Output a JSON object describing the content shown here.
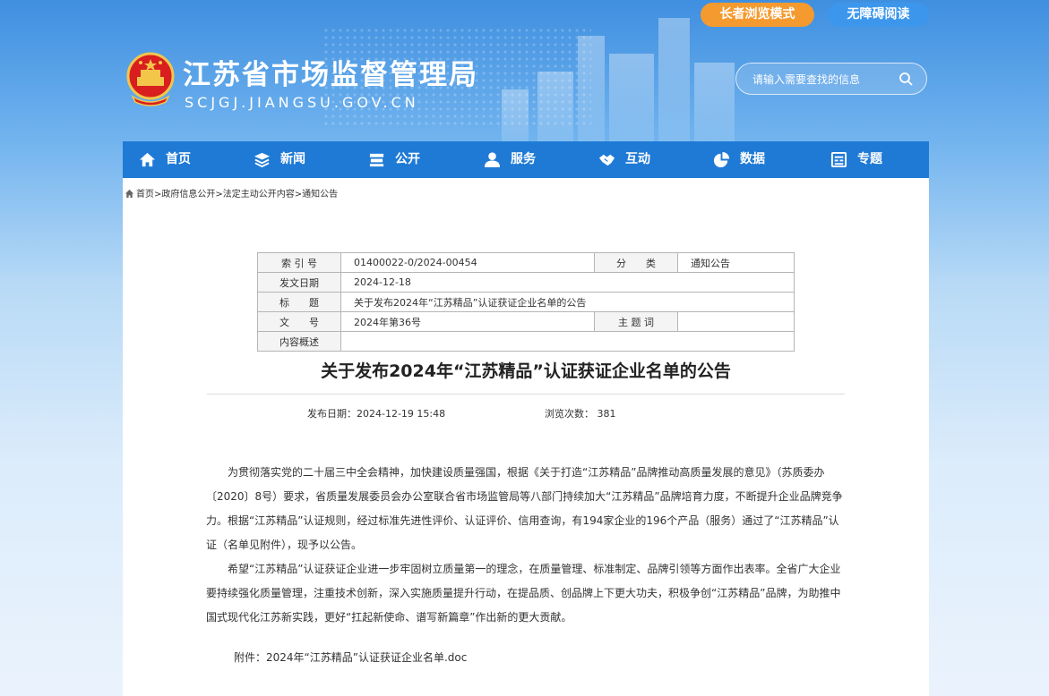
{
  "header": {
    "elder_mode_label": "长者浏览模式",
    "accessibility_label": "无障碍阅读",
    "site_title": "江苏省市场监督管理局",
    "site_url": "SCJGJ.JIANGSU.GOV.CN",
    "search_placeholder": "请输入需要查找的信息"
  },
  "nav": {
    "items": [
      {
        "label": "首页",
        "icon": "home-icon"
      },
      {
        "label": "新闻",
        "icon": "layers-icon"
      },
      {
        "label": "公开",
        "icon": "stack-icon"
      },
      {
        "label": "服务",
        "icon": "user-icon"
      },
      {
        "label": "互动",
        "icon": "handshake-icon"
      },
      {
        "label": "数据",
        "icon": "pie-icon"
      },
      {
        "label": "专题",
        "icon": "calendar-icon"
      }
    ]
  },
  "breadcrumb": [
    "首页",
    "政府信息公开",
    "法定主动公开内容",
    "通知公告"
  ],
  "meta": {
    "index_label": "索 引 号",
    "index_value": "01400022-0/2024-00454",
    "category_label": "分　　类",
    "category_value": "通知公告",
    "date_label": "发文日期",
    "date_value": "2024-12-18",
    "title_label": "标　　题",
    "title_value": "关于发布2024年“江苏精品”认证获证企业名单的公告",
    "docno_label": "文　　号",
    "docno_value": "2024年第36号",
    "subject_label": "主 题 词",
    "subject_value": "",
    "summary_label": "内容概述",
    "summary_value": ""
  },
  "article": {
    "title": "关于发布2024年“江苏精品”认证获证企业名单的公告",
    "publish_date": "发布日期：2024-12-19 15:48",
    "views": "浏览次数：  381",
    "paragraph1": "为贯彻落实党的二十届三中全会精神，加快建设质量强国，根据《关于打造“江苏精品”品牌推动高质量发展的意见》（苏质委办〔2020〕8号）要求，省质量发展委员会办公室联合省市场监管局等八部门持续加大“江苏精品”品牌培育力度，不断提升企业品牌竞争力。根据“江苏精品”认证规则，经过标准先进性评价、认证评价、信用查询，有194家企业的196个产品（服务）通过了“江苏精品”认证（名单见附件），现予以公告。",
    "paragraph2": "希望“江苏精品”认证获证企业进一步牢固树立质量第一的理念，在质量管理、标准制定、品牌引领等方面作出表率。全省广大企业要持续强化质量管理，注重技术创新，深入实施质量提升行动，在提品质、创品牌上下更大功夫，积极争创“江苏精品”品牌，为助推中国式现代化江苏新实践，更好“扛起新使命、谱写新篇章”作出新的更大贡献。",
    "attachment": "附件：2024年“江苏精品”认证获证企业名单.doc"
  },
  "colors": {
    "nav_bg": "#1f7ad6",
    "elder_btn": "#f59a2f",
    "access_btn": "#3c97ec"
  }
}
